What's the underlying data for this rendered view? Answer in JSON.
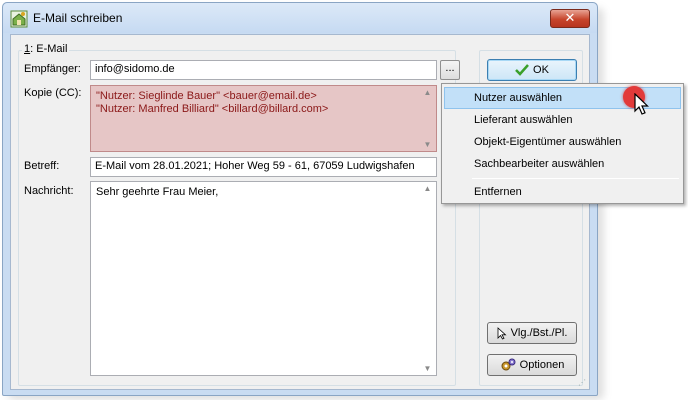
{
  "window": {
    "title": "E-Mail schreiben",
    "close_label": "✕"
  },
  "group": {
    "label_underlined": "1",
    "label_rest": ": E-Mail"
  },
  "fields": {
    "recipient_label": "Empfänger:",
    "recipient_value": "info@sidomo.de",
    "browse_label": "...",
    "cc_label": "Kopie (CC):",
    "cc_lines": [
      "\"Nutzer: Sieglinde Bauer\" <bauer@email.de>",
      "\"Nutzer: Manfred Billiard\" <billard@billard.com>"
    ],
    "subject_label": "Betreff:",
    "subject_value": "E-Mail vom 28.01.2021; Hoher Weg 59 - 61, 67059 Ludwigshafen",
    "message_label": "Nachricht:",
    "message_value": "Sehr geehrte Frau Meier,"
  },
  "buttons": {
    "ok_label": "OK",
    "vlg_label": "Vlg./Bst./Pl.",
    "options_label": "Optionen"
  },
  "context_menu": {
    "items": [
      "Nutzer auswählen",
      "Lieferant auswählen",
      "Objekt-Eigentümer auswählen",
      "Sachbearbeiter auswählen",
      "Entfernen"
    ],
    "highlighted_index": 0
  },
  "icons": {
    "app": "house-key-icon",
    "ok": "checkmark-icon",
    "vlg": "pointer-icon",
    "options": "gears-icon"
  },
  "colors": {
    "cc_background": "#e6c6c6",
    "cc_text": "#8b1818",
    "menu_highlight": "#c2e0f8",
    "cursor_marker": "#e23a3a"
  }
}
